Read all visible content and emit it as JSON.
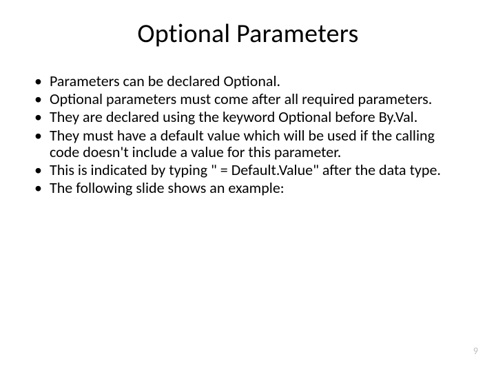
{
  "slide": {
    "title": "Optional Parameters",
    "bullets": [
      "Parameters can be declared Optional.",
      "Optional parameters must come after all required parameters.",
      "They are declared using the keyword Optional before By.Val.",
      "They must have a default value which will be used if the calling code doesn't include a value for this parameter.",
      "This is indicated by typing \" = Default.Value\" after the data type.",
      "The following slide shows an example:"
    ],
    "page_number": "9"
  }
}
